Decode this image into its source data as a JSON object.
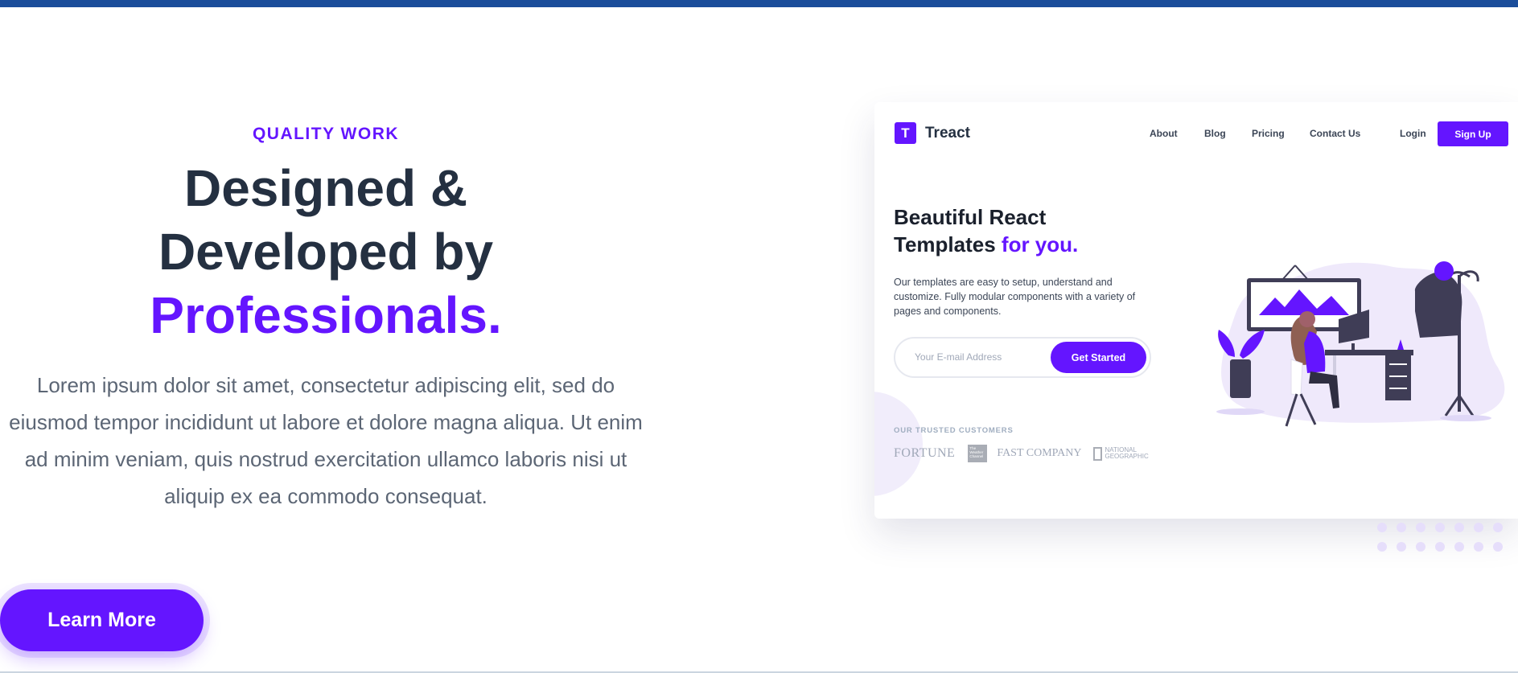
{
  "hero": {
    "eyebrow": "QUALITY WORK",
    "headline_line1": "Designed &",
    "headline_line2": "Developed by",
    "headline_accent": "Professionals.",
    "description": "Lorem ipsum dolor sit amet, consectetur adipiscing elit, sed do eiusmod tempor incididunt ut labore et dolore magna aliqua. Ut enim ad minim veniam, quis nostrud exercitation ullamco laboris nisi ut aliquip ex ea commodo consequat.",
    "cta_label": "Learn More"
  },
  "preview": {
    "logo_letter": "T",
    "brand": "Treact",
    "nav": {
      "about": "About",
      "blog": "Blog",
      "pricing": "Pricing",
      "contact": "Contact Us",
      "login": "Login",
      "signup": "Sign Up"
    },
    "title_line1": "Beautiful React",
    "title_line2": "Templates",
    "title_accent": "for you.",
    "description": "Our templates are easy to setup, understand and customize. Fully modular components with a variety of pages and components.",
    "email_placeholder": "Your E-mail Address",
    "cta_label": "Get Started",
    "trusted_label": "OUR TRUSTED CUSTOMERS",
    "customer_logos": {
      "fortune": "FORTUNE",
      "weather": "The Weather Channel",
      "fastcompany": "FAST COMPANY",
      "natgeo_line1": "NATIONAL",
      "natgeo_line2": "GEOGRAPHIC"
    }
  },
  "colors": {
    "accent": "#6415ff",
    "heading": "#243041",
    "body_text": "#5c6675",
    "top_bar": "#1b4d9a"
  }
}
